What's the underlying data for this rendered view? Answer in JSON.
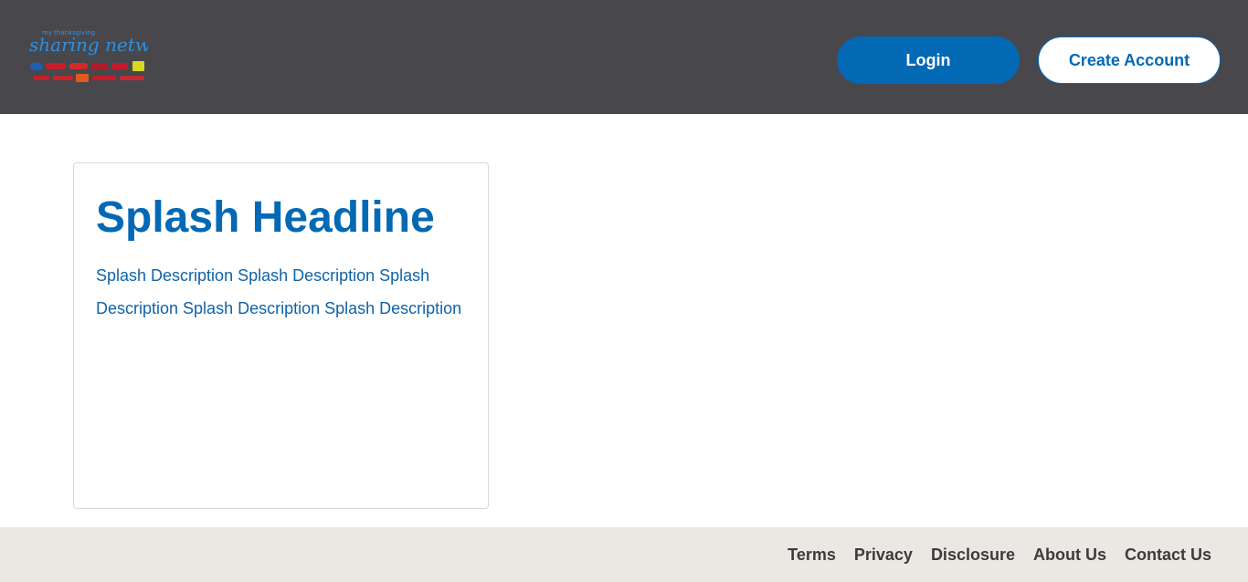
{
  "header": {
    "logo": {
      "name": "logo-image",
      "text": "my thanksgiving sharing network"
    },
    "login_label": "Login",
    "create_account_label": "Create Account"
  },
  "splash": {
    "headline": "Splash Headline",
    "description": "Splash Description Splash Description Splash Description Splash Description Splash Description"
  },
  "footer": {
    "links": [
      {
        "label": "Terms"
      },
      {
        "label": "Privacy"
      },
      {
        "label": "Disclosure"
      },
      {
        "label": "About Us"
      },
      {
        "label": "Contact Us"
      }
    ]
  },
  "colors": {
    "header_bg": "#48474c",
    "accent": "#0369b5",
    "footer_bg": "#ebe7e3"
  }
}
